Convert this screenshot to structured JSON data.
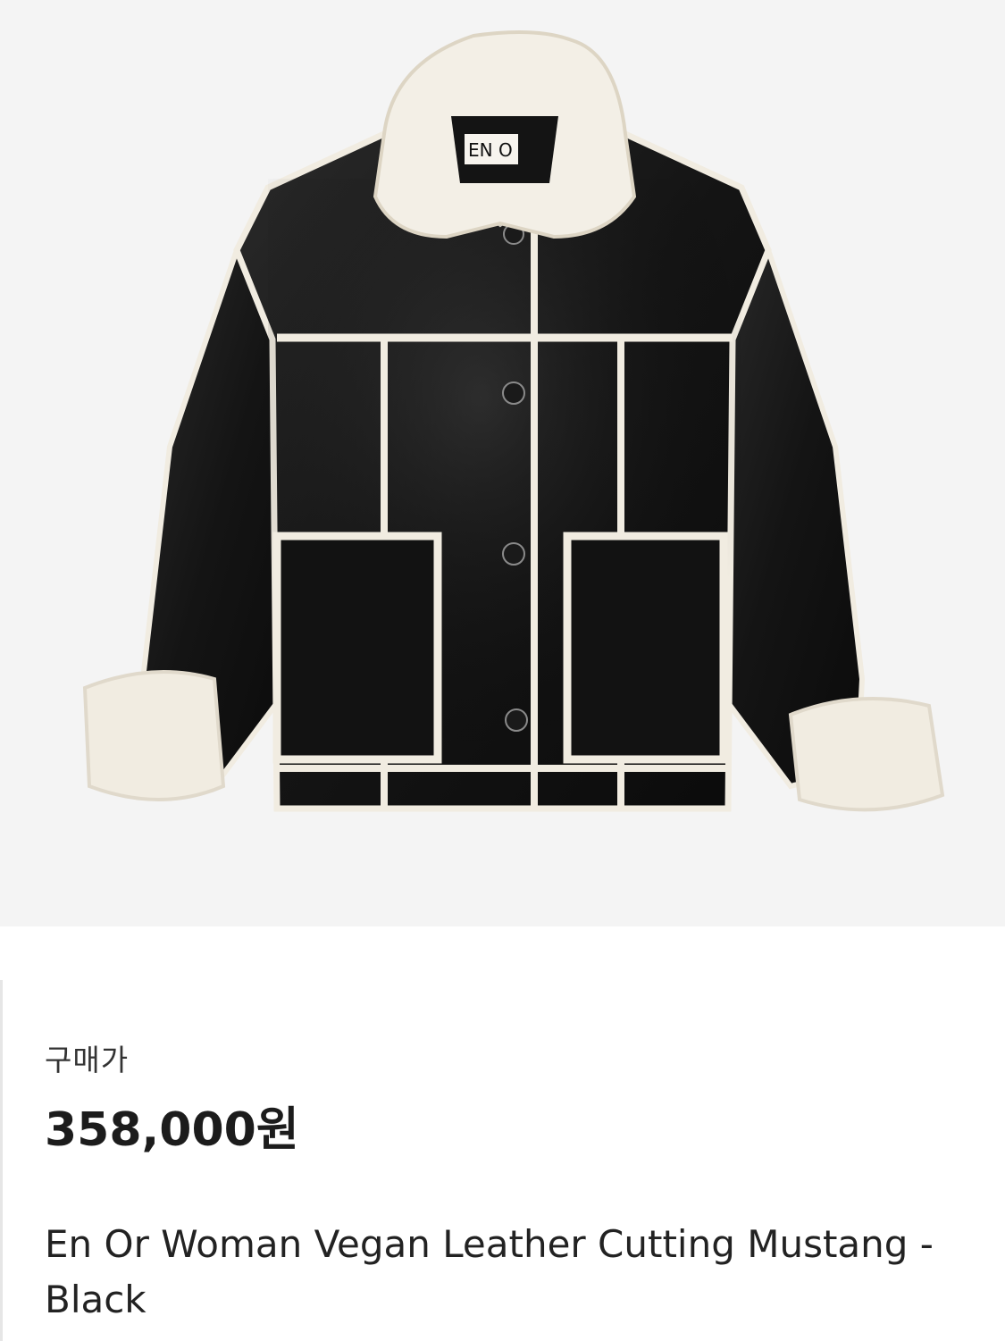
{
  "product": {
    "image_label": "EN O",
    "price_label": "구매가",
    "price": "358,000원",
    "name": "En Or Woman Vegan Leather Cutting Mustang - Black"
  },
  "colors": {
    "hero_background": "#f4f4f4",
    "leather": "#151515",
    "shearling": "#f1ece1",
    "text_primary": "#1c1c1c"
  }
}
